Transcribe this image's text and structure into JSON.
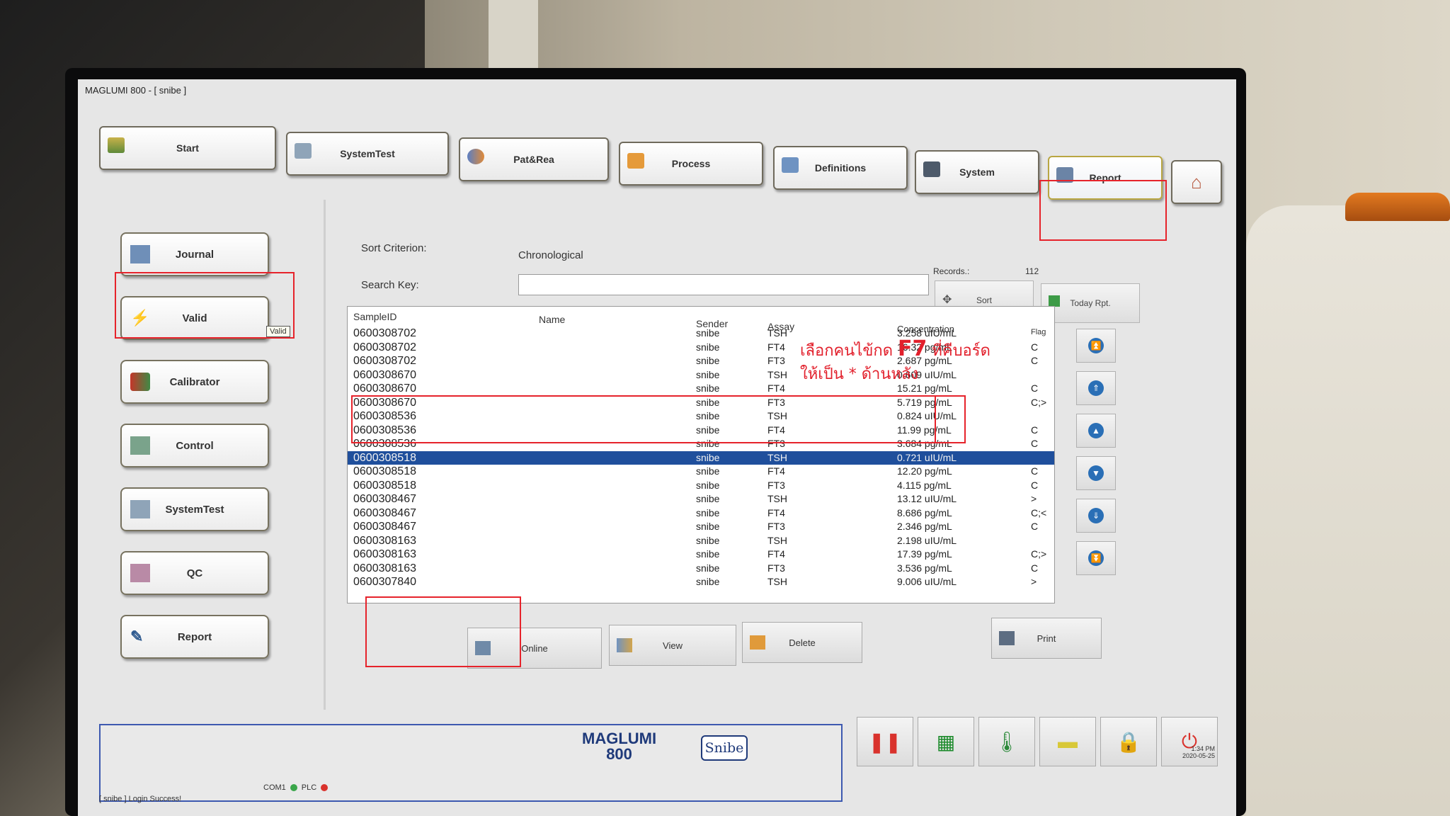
{
  "window": {
    "title": "MAGLUMI 800 - [ snibe ]"
  },
  "top_tabs": [
    {
      "label": "Start"
    },
    {
      "label": "SystemTest"
    },
    {
      "label": "Pat&Rea"
    },
    {
      "label": "Process"
    },
    {
      "label": "Definitions"
    },
    {
      "label": "System"
    },
    {
      "label": "Report"
    }
  ],
  "left_menu": [
    {
      "label": "Journal"
    },
    {
      "label": "Valid"
    },
    {
      "label": "Calibrator"
    },
    {
      "label": "Control"
    },
    {
      "label": "SystemTest"
    },
    {
      "label": "QC"
    },
    {
      "label": "Report"
    }
  ],
  "tooltip": "Valid",
  "main": {
    "sort_label": "Sort Criterion:",
    "sort_value": "Chronological",
    "search_label": "Search Key:",
    "search_value": "",
    "records_label": "Records.:",
    "records_value": "112",
    "sort_button": "Sort",
    "today_button": "Today Rpt."
  },
  "table": {
    "headers": {
      "sample_id": "SampleID",
      "name": "Name",
      "sender": "Sender",
      "assay": "Assay",
      "concentration": "Concentration",
      "flag": "Flag"
    },
    "rows": [
      {
        "id": "0600308702",
        "sender": "snibe",
        "assay": "TSH",
        "conc": "3.258 uIU/mL",
        "flag": "",
        "mark": ""
      },
      {
        "id": "0600308702",
        "sender": "snibe",
        "assay": "FT4",
        "conc": "16.32 pg/mL",
        "flag": "C",
        "mark": ""
      },
      {
        "id": "0600308702",
        "sender": "snibe",
        "assay": "FT3",
        "conc": "2.687 pg/mL",
        "flag": "C",
        "mark": ""
      },
      {
        "id": "0600308670",
        "sender": "snibe",
        "assay": "TSH",
        "conc": "0.609 uIU/mL",
        "flag": "",
        "mark": ""
      },
      {
        "id": "0600308670",
        "sender": "snibe",
        "assay": "FT4",
        "conc": "15.21 pg/mL",
        "flag": "C",
        "mark": ""
      },
      {
        "id": "0600308670",
        "sender": "snibe",
        "assay": "FT3",
        "conc": "5.719 pg/mL",
        "flag": "C;>",
        "mark": ""
      },
      {
        "id": "0600308536",
        "sender": "snibe",
        "assay": "TSH",
        "conc": "0.824 uIU/mL",
        "flag": "",
        "mark": "*"
      },
      {
        "id": "0600308536",
        "sender": "snibe",
        "assay": "FT4",
        "conc": "11.99 pg/mL",
        "flag": "C",
        "mark": "*"
      },
      {
        "id": "0600308536",
        "sender": "snibe",
        "assay": "FT3",
        "conc": "3.684 pg/mL",
        "flag": "C",
        "mark": "*"
      },
      {
        "id": "0600308518",
        "sender": "snibe",
        "assay": "TSH",
        "conc": "0.721 uIU/mL",
        "flag": "",
        "mark": ""
      },
      {
        "id": "0600308518",
        "sender": "snibe",
        "assay": "FT4",
        "conc": "12.20 pg/mL",
        "flag": "C",
        "mark": ""
      },
      {
        "id": "0600308518",
        "sender": "snibe",
        "assay": "FT3",
        "conc": "4.115 pg/mL",
        "flag": "C",
        "mark": ""
      },
      {
        "id": "0600308467",
        "sender": "snibe",
        "assay": "TSH",
        "conc": "13.12 uIU/mL",
        "flag": ">",
        "mark": ""
      },
      {
        "id": "0600308467",
        "sender": "snibe",
        "assay": "FT4",
        "conc": "8.686 pg/mL",
        "flag": "C;<",
        "mark": ""
      },
      {
        "id": "0600308467",
        "sender": "snibe",
        "assay": "FT3",
        "conc": "2.346 pg/mL",
        "flag": "C",
        "mark": ""
      },
      {
        "id": "0600308163",
        "sender": "snibe",
        "assay": "TSH",
        "conc": "2.198 uIU/mL",
        "flag": "",
        "mark": ""
      },
      {
        "id": "0600308163",
        "sender": "snibe",
        "assay": "FT4",
        "conc": "17.39 pg/mL",
        "flag": "C;>",
        "mark": ""
      },
      {
        "id": "0600308163",
        "sender": "snibe",
        "assay": "FT3",
        "conc": "3.536 pg/mL",
        "flag": "C",
        "mark": ""
      },
      {
        "id": "0600307840",
        "sender": "snibe",
        "assay": "TSH",
        "conc": "9.006 uIU/mL",
        "flag": ">",
        "mark": ""
      }
    ]
  },
  "annotation": {
    "line1_pre": "เลือกคนไข้กด ",
    "line1_key": "F7",
    "line1_post": " ที่คีบอร์ด",
    "line2": "ให้เป็น * ด้านหลัง"
  },
  "bottom_buttons": {
    "online": "Online",
    "view": "View",
    "delete": "Delete",
    "print": "Print"
  },
  "brand": {
    "line1": "MAGLUMI",
    "line2": "800",
    "badge": "Snibe"
  },
  "status": {
    "login": "[ snibe ] Login Success!",
    "com": "COM1",
    "plc": "PLC",
    "time": "1:34 PM",
    "date": "2020-05-25"
  },
  "colors": {
    "highlight": "#e6232b",
    "selection": "#1f4f9c",
    "accent_blue": "#2a6fb6"
  }
}
